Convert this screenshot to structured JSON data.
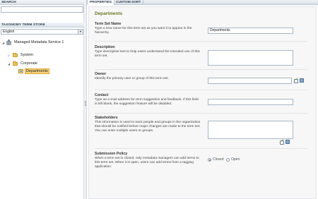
{
  "left_pane": {
    "search_header": "SEARCH",
    "store_header": "TAXONOMY TERM STORE",
    "language": "English",
    "tree": {
      "service": "Managed Metadata Service 1",
      "groups": [
        "System",
        "Corporate"
      ],
      "selected_termset": "Departments"
    }
  },
  "tabs": [
    "PROPERTIES",
    "CUSTOM SORT"
  ],
  "form": {
    "title": "Departments",
    "term_set_name": {
      "label": "Term Set Name",
      "desc": "Type a new name for this term set as you want it to appear in the hierarchy.",
      "value": "Departments"
    },
    "description": {
      "label": "Description",
      "desc": "Type descriptive text to help users understand the intended use of this term set."
    },
    "owner": {
      "label": "Owner",
      "desc": "Identify the primary user or group of this term set."
    },
    "contact": {
      "label": "Contact",
      "desc": "Type an e-mail address for term suggestion and feedback. If this field is left blank, the suggestion feature will be disabled."
    },
    "stakeholders": {
      "label": "Stakeholders",
      "desc": "This information is used to track people and groups in the organization that should be notified before major changes are made to the term set. You can enter multiple users or groups."
    },
    "submission_policy": {
      "label": "Submission Policy",
      "desc": "When a term set is closed, only metadata managers can add terms to this term set. When it is open, users can add terms from a tagging application.",
      "options": [
        "Closed",
        "Open"
      ],
      "selected": "Closed"
    }
  }
}
